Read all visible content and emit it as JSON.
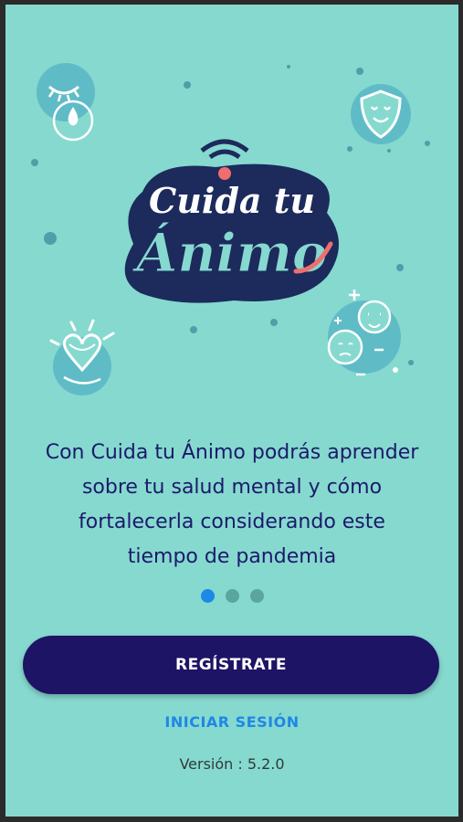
{
  "logo": {
    "line1": "Cuida tu",
    "line2": "Ánimo"
  },
  "description": {
    "line1": "Con Cuida tu Ánimo podrás aprender",
    "line2": "sobre tu salud mental y cómo",
    "line3": "fortalecerla considerando este",
    "line4": "tiempo de pandemia"
  },
  "pager": {
    "count": 3,
    "active_index": 0
  },
  "buttons": {
    "register_label": "REGÍSTRATE",
    "login_label": "INICIAR SESIÓN"
  },
  "footer": {
    "version": "Versión : 5.2.0"
  },
  "icons": [
    "sleep-tear-icon",
    "shield-icon",
    "heart-icon",
    "faces-icon"
  ],
  "colors": {
    "background": "#86d9cf",
    "primary": "#1d1466",
    "accent": "#1e88e5",
    "logo_smile": "#f06e6e"
  }
}
